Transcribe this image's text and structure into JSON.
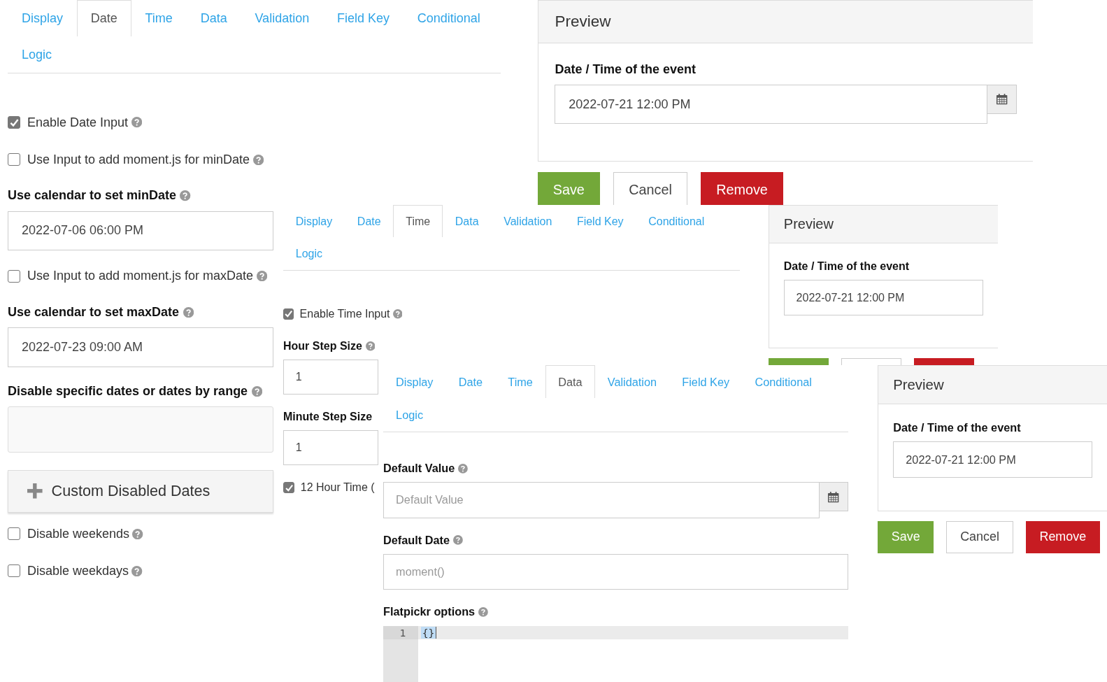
{
  "screens": [
    {
      "editor": {
        "tabs": [
          {
            "label": "Display",
            "selected": false
          },
          {
            "label": "Date",
            "selected": true
          },
          {
            "label": "Time",
            "selected": false
          },
          {
            "label": "Data",
            "selected": false
          },
          {
            "label": "Validation",
            "selected": false
          },
          {
            "label": "Field Key",
            "selected": false
          },
          {
            "label": "Conditional",
            "selected": false
          },
          {
            "label": "Logic",
            "selected": false
          }
        ],
        "fields": [
          {
            "kind": "checkbox",
            "label": "Enable Date Input",
            "checked": true,
            "help": true
          },
          {
            "kind": "checkbox",
            "label": "Use Input to add moment.js for minDate",
            "checked": false,
            "help": true
          },
          {
            "kind": "label",
            "text": "Use calendar to set minDate",
            "help": true
          },
          {
            "kind": "input",
            "value": "2022-07-06 06:00 PM"
          },
          {
            "kind": "checkbox",
            "label": "Use Input to add moment.js for maxDate",
            "checked": false,
            "help": true
          },
          {
            "kind": "label",
            "text": "Use calendar to set maxDate",
            "help": true
          },
          {
            "kind": "input",
            "value": "2022-07-23 09:00 AM"
          },
          {
            "kind": "label",
            "text": "Disable specific dates or dates by range",
            "help": true
          },
          {
            "kind": "textarea"
          },
          {
            "kind": "panel",
            "title": "Custom Disabled Dates"
          },
          {
            "kind": "checkbox",
            "label": "Disable weekends",
            "checked": false,
            "help": true
          },
          {
            "kind": "checkbox",
            "label": "Disable weekdays",
            "checked": false,
            "help": true
          }
        ]
      },
      "preview": {
        "title": "Preview",
        "label": "Date / Time of the event",
        "field": {
          "kind": "date_input",
          "value": "2022-07-21 12:00 PM"
        }
      },
      "buttons": [
        {
          "kind": "save",
          "label": "Save"
        },
        {
          "kind": "cancel",
          "label": "Cancel"
        },
        {
          "kind": "remove",
          "label": "Remove"
        }
      ]
    },
    {
      "editor": {
        "tabs": [
          {
            "label": "Display",
            "selected": false
          },
          {
            "label": "Date",
            "selected": false
          },
          {
            "label": "Time",
            "selected": true
          },
          {
            "label": "Data",
            "selected": false
          },
          {
            "label": "Validation",
            "selected": false
          },
          {
            "label": "Field Key",
            "selected": false
          },
          {
            "label": "Conditional",
            "selected": false
          },
          {
            "label": "Logic",
            "selected": false
          }
        ],
        "fields": [
          {
            "kind": "checkbox",
            "label": "Enable Time Input",
            "checked": true,
            "help": true
          },
          {
            "kind": "label",
            "text": "Hour Step Size",
            "help": true
          },
          {
            "kind": "input",
            "value": "1"
          },
          {
            "kind": "label",
            "text": "Minute Step Size"
          },
          {
            "kind": "input",
            "value": "1"
          },
          {
            "kind": "checkbox",
            "label": "12 Hour Time (",
            "checked": true
          }
        ]
      },
      "preview": {
        "title": "Preview",
        "label": "Date / Time of the event",
        "field": {
          "kind": "input",
          "value": "2022-07-21 12:00 PM"
        }
      },
      "buttons": [
        {
          "kind": "save"
        },
        {
          "kind": "cancel"
        },
        {
          "kind": "remove"
        }
      ]
    },
    {
      "editor": {
        "tabs": [
          {
            "label": "Display",
            "selected": false
          },
          {
            "label": "Date",
            "selected": false
          },
          {
            "label": "Time",
            "selected": false
          },
          {
            "label": "Data",
            "selected": true
          },
          {
            "label": "Validation",
            "selected": false
          },
          {
            "label": "Field Key",
            "selected": false
          },
          {
            "label": "Conditional",
            "selected": false
          },
          {
            "label": "Logic",
            "selected": false
          }
        ],
        "fields": [
          {
            "kind": "label",
            "text": "Default Value",
            "help": true
          },
          {
            "kind": "date_input",
            "placeholder": "Default Value"
          },
          {
            "kind": "label",
            "text": "Default Date",
            "help": true
          },
          {
            "kind": "input",
            "placeholder": "moment()"
          },
          {
            "kind": "label",
            "text": "Flatpickr options",
            "help": true
          },
          {
            "kind": "code",
            "line_number": "1",
            "code": "{}"
          }
        ]
      },
      "preview": {
        "title": "Preview",
        "label": "Date / Time of the event",
        "field": {
          "kind": "input",
          "value": "2022-07-21 12:00 PM"
        }
      },
      "buttons": [
        {
          "kind": "save",
          "label": "Save"
        },
        {
          "kind": "cancel",
          "label": "Cancel"
        },
        {
          "kind": "remove",
          "label": "Remove"
        }
      ]
    }
  ]
}
